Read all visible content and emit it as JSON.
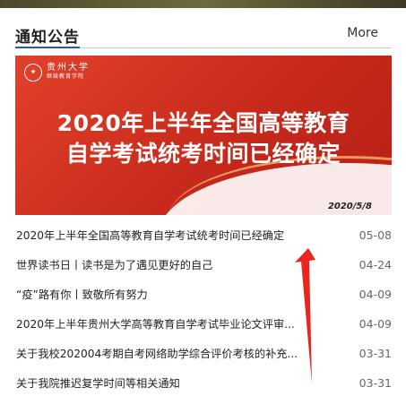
{
  "header": {
    "title": "通知公告",
    "more": "More"
  },
  "banner": {
    "logo_name": "贵州大学",
    "logo_sub": "继续教育学院",
    "headline_line1": "2020年上半年全国高等教育",
    "headline_line2": "自学考试统考时间已经确定",
    "date": "2020/5/8"
  },
  "items": [
    {
      "title": "2020年上半年全国高等教育自学考试统考时间已经确定",
      "date": "05-08"
    },
    {
      "title": "世界读书日丨读书是为了遇见更好的自己",
      "date": "04-24"
    },
    {
      "title": "“疫”路有你丨致敬所有努力",
      "date": "04-09"
    },
    {
      "title": "2020年上半年贵州大学高等教育自学考试毕业论文评审...",
      "date": "04-09"
    },
    {
      "title": "关于我校202004考期自考网络助学综合评价考核的补充...",
      "date": "03-31"
    },
    {
      "title": "关于我院推迟复学时间等相关通知",
      "date": "03-31"
    }
  ],
  "colors": {
    "accent": "#2a5c9a",
    "banner_red": "#d6331f",
    "annotation_arrow": "#e8261e"
  }
}
